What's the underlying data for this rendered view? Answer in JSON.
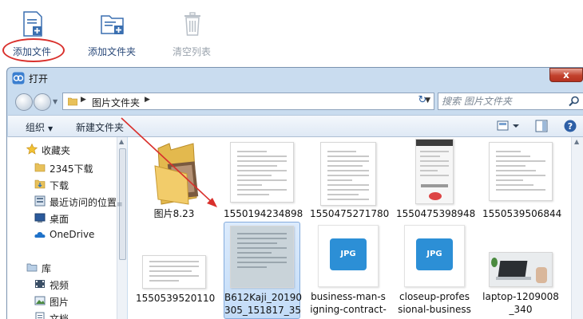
{
  "toolbar": {
    "add_file": "添加文件",
    "add_folder": "添加文件夹",
    "clear_list": "清空列表"
  },
  "dialog": {
    "title": "打开",
    "close_label": "x",
    "address": {
      "folder": "图片文件夹"
    },
    "search": {
      "placeholder": "搜索 图片文件夹"
    },
    "commands": {
      "organize": "组织",
      "new_folder": "新建文件夹"
    }
  },
  "nav": {
    "items": [
      {
        "label": "收藏夹",
        "icon": "star-icon"
      },
      {
        "label": "2345下载",
        "icon": "folder-icon"
      },
      {
        "label": "下载",
        "icon": "download-folder-icon"
      },
      {
        "label": "最近访问的位置",
        "icon": "recent-places-icon"
      },
      {
        "label": "桌面",
        "icon": "desktop-icon"
      },
      {
        "label": "OneDrive",
        "icon": "onedrive-icon"
      },
      {
        "label": "库",
        "icon": "library-icon"
      },
      {
        "label": "视频",
        "icon": "video-library-icon"
      },
      {
        "label": "图片",
        "icon": "pictures-library-icon"
      },
      {
        "label": "文档",
        "icon": "documents-library-icon"
      }
    ]
  },
  "files": [
    {
      "name": "图片8.23",
      "kind": "folder"
    },
    {
      "name": "1550194234898",
      "kind": "document-image"
    },
    {
      "name": "1550475271780",
      "kind": "document-image"
    },
    {
      "name": "1550475398948",
      "kind": "phone-screenshot"
    },
    {
      "name": "1550539506844",
      "kind": "document-image"
    },
    {
      "name": "1550539520110",
      "kind": "document-image"
    },
    {
      "name_lines": [
        "B612Kaji_20190",
        "305_151817_35"
      ],
      "kind": "photo",
      "selected": true
    },
    {
      "name_lines": [
        "business-man-s",
        "igning-contract-"
      ],
      "kind": "jpg"
    },
    {
      "name_lines": [
        "closeup-profes",
        "sional-business"
      ],
      "kind": "jpg"
    },
    {
      "name_lines": [
        "laptop-1209008",
        "_340"
      ],
      "kind": "laptop-photo"
    }
  ],
  "jpg_badge": "JPG",
  "colors": {
    "annotation_red": "#d9302c",
    "window_frame": "#c9dcef",
    "toolbar_text": "#2b4a7a"
  }
}
